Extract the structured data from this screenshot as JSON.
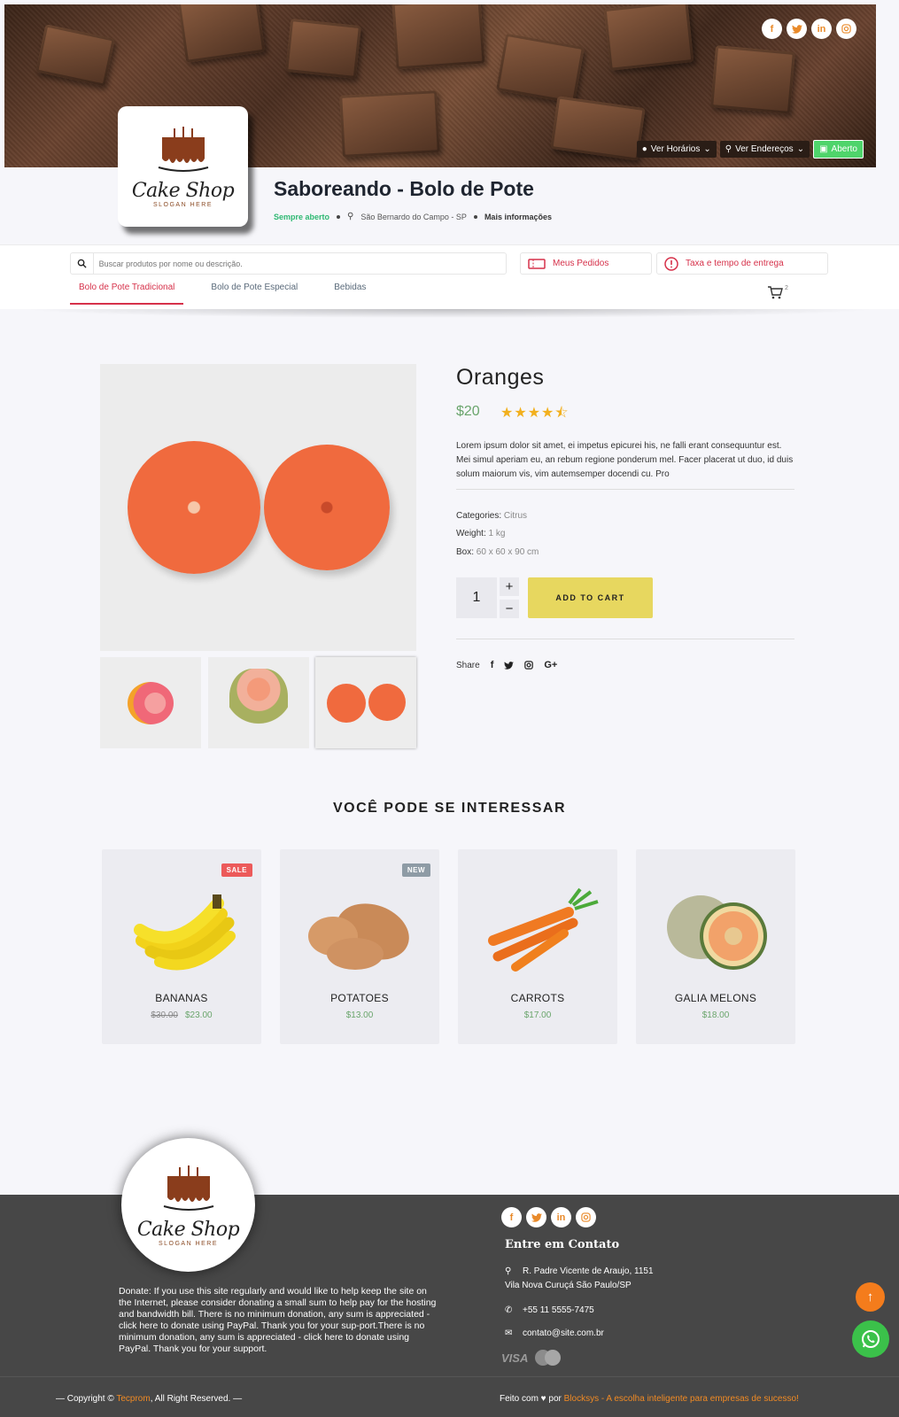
{
  "header": {
    "social": [
      "f",
      "t",
      "in",
      "ig"
    ],
    "buttons": {
      "hours": "Ver Horários",
      "addresses": "Ver Endereços",
      "status": "Aberto"
    },
    "logo": {
      "name": "Cake Shop",
      "slogan": "SLOGAN HERE"
    },
    "store_name": "Saboreando - Bolo de Pote",
    "meta": {
      "open": "Sempre aberto",
      "location": "São Bernardo do Campo - SP",
      "more": "Mais informações"
    }
  },
  "nav": {
    "search_placeholder": "Buscar produtos por nome ou descrição.",
    "orders": "Meus Pedidos",
    "delivery": "Taxa e tempo de entrega",
    "tabs": [
      "Bolo de Pote Tradicional",
      "Bolo de Pote Especial",
      "Bebidas"
    ],
    "cart_count": "2"
  },
  "product": {
    "title": "Oranges",
    "price": "$20",
    "rating": 4.5,
    "stars": "★★★★⯪",
    "description": "Lorem ipsum dolor sit amet, ei impetus epicurei his, ne falli erant consequuntur est. Mei simul aperiam eu, an rebum regione ponderum mel. Facer placerat ut duo, id duis solum maiorum vis, vim autemsemper docendi cu. Pro",
    "categories_label": "Categories:",
    "categories_value": "Citrus",
    "weight_label": "Weight:",
    "weight_value": "1 kg",
    "box_label": "Box:",
    "box_value": "60 x 60 x 90 cm",
    "quantity": "1",
    "plus": "+",
    "minus": "−",
    "add_to_cart": "ADD TO CART",
    "share_label": "Share"
  },
  "related": {
    "title": "VOCÊ PODE SE INTERESSAR",
    "items": [
      {
        "name": "BANANAS",
        "old_price": "$30.00",
        "price": "$23.00",
        "badge": "SALE"
      },
      {
        "name": "POTATOES",
        "price": "$13.00",
        "badge": "NEW"
      },
      {
        "name": "CARROTS",
        "price": "$17.00"
      },
      {
        "name": "GALIA MELONS",
        "price": "$18.00"
      }
    ]
  },
  "footer": {
    "donate": "Donate: If you use this site regularly and would like to help keep the site on the Internet, please consider donating a small sum to help pay for the hosting and bandwidth bill. There is no minimum donation, any sum is appreciated - click here to donate using PayPal. Thank you for your sup-port.There is no minimum donation, any sum is appreciated - click here to donate using PayPal. Thank you for your support.",
    "contact_title": "Entre em Contato",
    "address_1": "R. Padre Vicente de Araujo, 1151",
    "address_2": "Vila Nova Curuçá São Paulo/SP",
    "phone": "+55 11 5555-7475",
    "email": "contato@site.com.br",
    "payment_visa": "VISA",
    "copyright_pre": "— Copyright ©",
    "copyright_link": "Tecprom",
    "copyright_post": ", All Right Reserved. —",
    "made_pre": "Feito com ♥ por",
    "made_link": "Blocksys - A escolha inteligente para empresas de sucesso!"
  },
  "colors": {
    "accent_red": "#d6314a",
    "price_green": "#6aa56c",
    "add_to_cart": "#e7d75f",
    "footer_bg": "#474747",
    "orange": "#f08a24",
    "whatsapp": "#3bc14a"
  }
}
